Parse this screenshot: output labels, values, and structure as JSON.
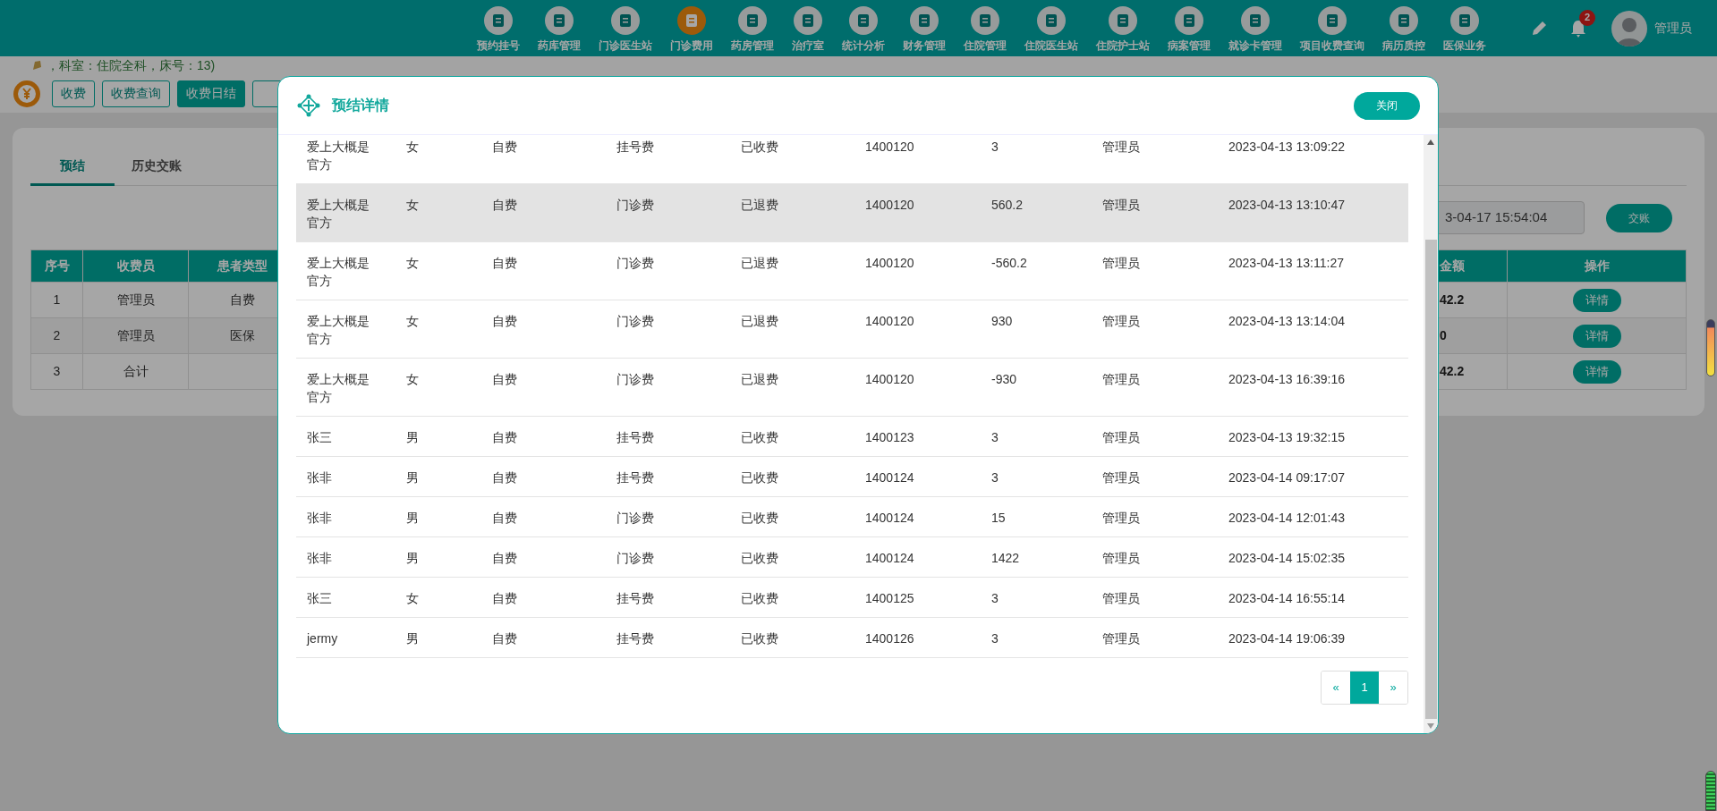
{
  "nav": [
    {
      "label": "预约挂号",
      "selected": false
    },
    {
      "label": "药库管理",
      "selected": false
    },
    {
      "label": "门诊医生站",
      "selected": false
    },
    {
      "label": "门诊费用",
      "selected": true
    },
    {
      "label": "药房管理",
      "selected": false
    },
    {
      "label": "治疗室",
      "selected": false
    },
    {
      "label": "统计分析",
      "selected": false
    },
    {
      "label": "财务管理",
      "selected": false
    },
    {
      "label": "住院管理",
      "selected": false
    },
    {
      "label": "住院医生站",
      "selected": false
    },
    {
      "label": "住院护士站",
      "selected": false
    },
    {
      "label": "病案管理",
      "selected": false
    },
    {
      "label": "就诊卡管理",
      "selected": false
    },
    {
      "label": "项目收费查询",
      "selected": false
    },
    {
      "label": "病历质控",
      "selected": false
    },
    {
      "label": "医保业务",
      "selected": false
    }
  ],
  "user": {
    "badge": "2",
    "name": "管理员"
  },
  "notice": "，科室：住院全科，床号：13)",
  "toolbar": [
    {
      "label": "收费",
      "selected": false
    },
    {
      "label": "收费查询",
      "selected": false
    },
    {
      "label": "收费日结",
      "selected": true
    },
    {
      "selected": false
    }
  ],
  "tabs": [
    {
      "label": "预结",
      "selected": true
    },
    {
      "label": "历史交账",
      "selected": false
    }
  ],
  "date_field": {
    "value": "3-04-17 15:54:04"
  },
  "submit_button": "交账",
  "summary_table": {
    "columns": [
      "序号",
      "收费员",
      "患者类型",
      "",
      "金额",
      "操作"
    ],
    "rows": [
      {
        "cells": [
          "1",
          "管理员",
          "自费",
          "",
          "42.2"
        ],
        "action": "详情"
      },
      {
        "cells": [
          "2",
          "管理员",
          "医保",
          "",
          "0"
        ],
        "action": "详情"
      },
      {
        "cells": [
          "3",
          "合计",
          "",
          "",
          "42.2"
        ],
        "action": "详情"
      }
    ]
  },
  "dialog": {
    "title": "预结详情",
    "close": "关闭",
    "rows": [
      {
        "cells": [
          "爱上大概是官方",
          "女",
          "自费",
          "挂号费",
          "已收费",
          "1400120",
          "3",
          "管理员",
          "2023-04-13 13:09:22"
        ],
        "highlighted": false
      },
      {
        "cells": [
          "爱上大概是官方",
          "女",
          "自费",
          "门诊费",
          "已退费",
          "1400120",
          "560.2",
          "管理员",
          "2023-04-13 13:10:47"
        ],
        "highlighted": true
      },
      {
        "cells": [
          "爱上大概是官方",
          "女",
          "自费",
          "门诊费",
          "已退费",
          "1400120",
          "-560.2",
          "管理员",
          "2023-04-13 13:11:27"
        ],
        "highlighted": false
      },
      {
        "cells": [
          "爱上大概是官方",
          "女",
          "自费",
          "门诊费",
          "已退费",
          "1400120",
          "930",
          "管理员",
          "2023-04-13 13:14:04"
        ],
        "highlighted": false
      },
      {
        "cells": [
          "爱上大概是官方",
          "女",
          "自费",
          "门诊费",
          "已退费",
          "1400120",
          "-930",
          "管理员",
          "2023-04-13 16:39:16"
        ],
        "highlighted": false
      },
      {
        "cells": [
          "张三",
          "男",
          "自费",
          "挂号费",
          "已收费",
          "1400123",
          "3",
          "管理员",
          "2023-04-13 19:32:15"
        ],
        "highlighted": false
      },
      {
        "cells": [
          "张非",
          "男",
          "自费",
          "挂号费",
          "已收费",
          "1400124",
          "3",
          "管理员",
          "2023-04-14 09:17:07"
        ],
        "highlighted": false
      },
      {
        "cells": [
          "张非",
          "男",
          "自费",
          "门诊费",
          "已收费",
          "1400124",
          "15",
          "管理员",
          "2023-04-14 12:01:43"
        ],
        "highlighted": false
      },
      {
        "cells": [
          "张非",
          "男",
          "自费",
          "门诊费",
          "已收费",
          "1400124",
          "1422",
          "管理员",
          "2023-04-14 15:02:35"
        ],
        "highlighted": false
      },
      {
        "cells": [
          "张三",
          "女",
          "自费",
          "挂号费",
          "已收费",
          "1400125",
          "3",
          "管理员",
          "2023-04-14 16:55:14"
        ],
        "highlighted": false
      },
      {
        "cells": [
          "jermy",
          "男",
          "自费",
          "挂号费",
          "已收费",
          "1400126",
          "3",
          "管理员",
          "2023-04-14 19:06:39"
        ],
        "highlighted": false
      }
    ],
    "pagination": [
      {
        "label": "«",
        "selected": false
      },
      {
        "label": "1",
        "selected": true
      },
      {
        "label": "»",
        "selected": false
      }
    ]
  }
}
